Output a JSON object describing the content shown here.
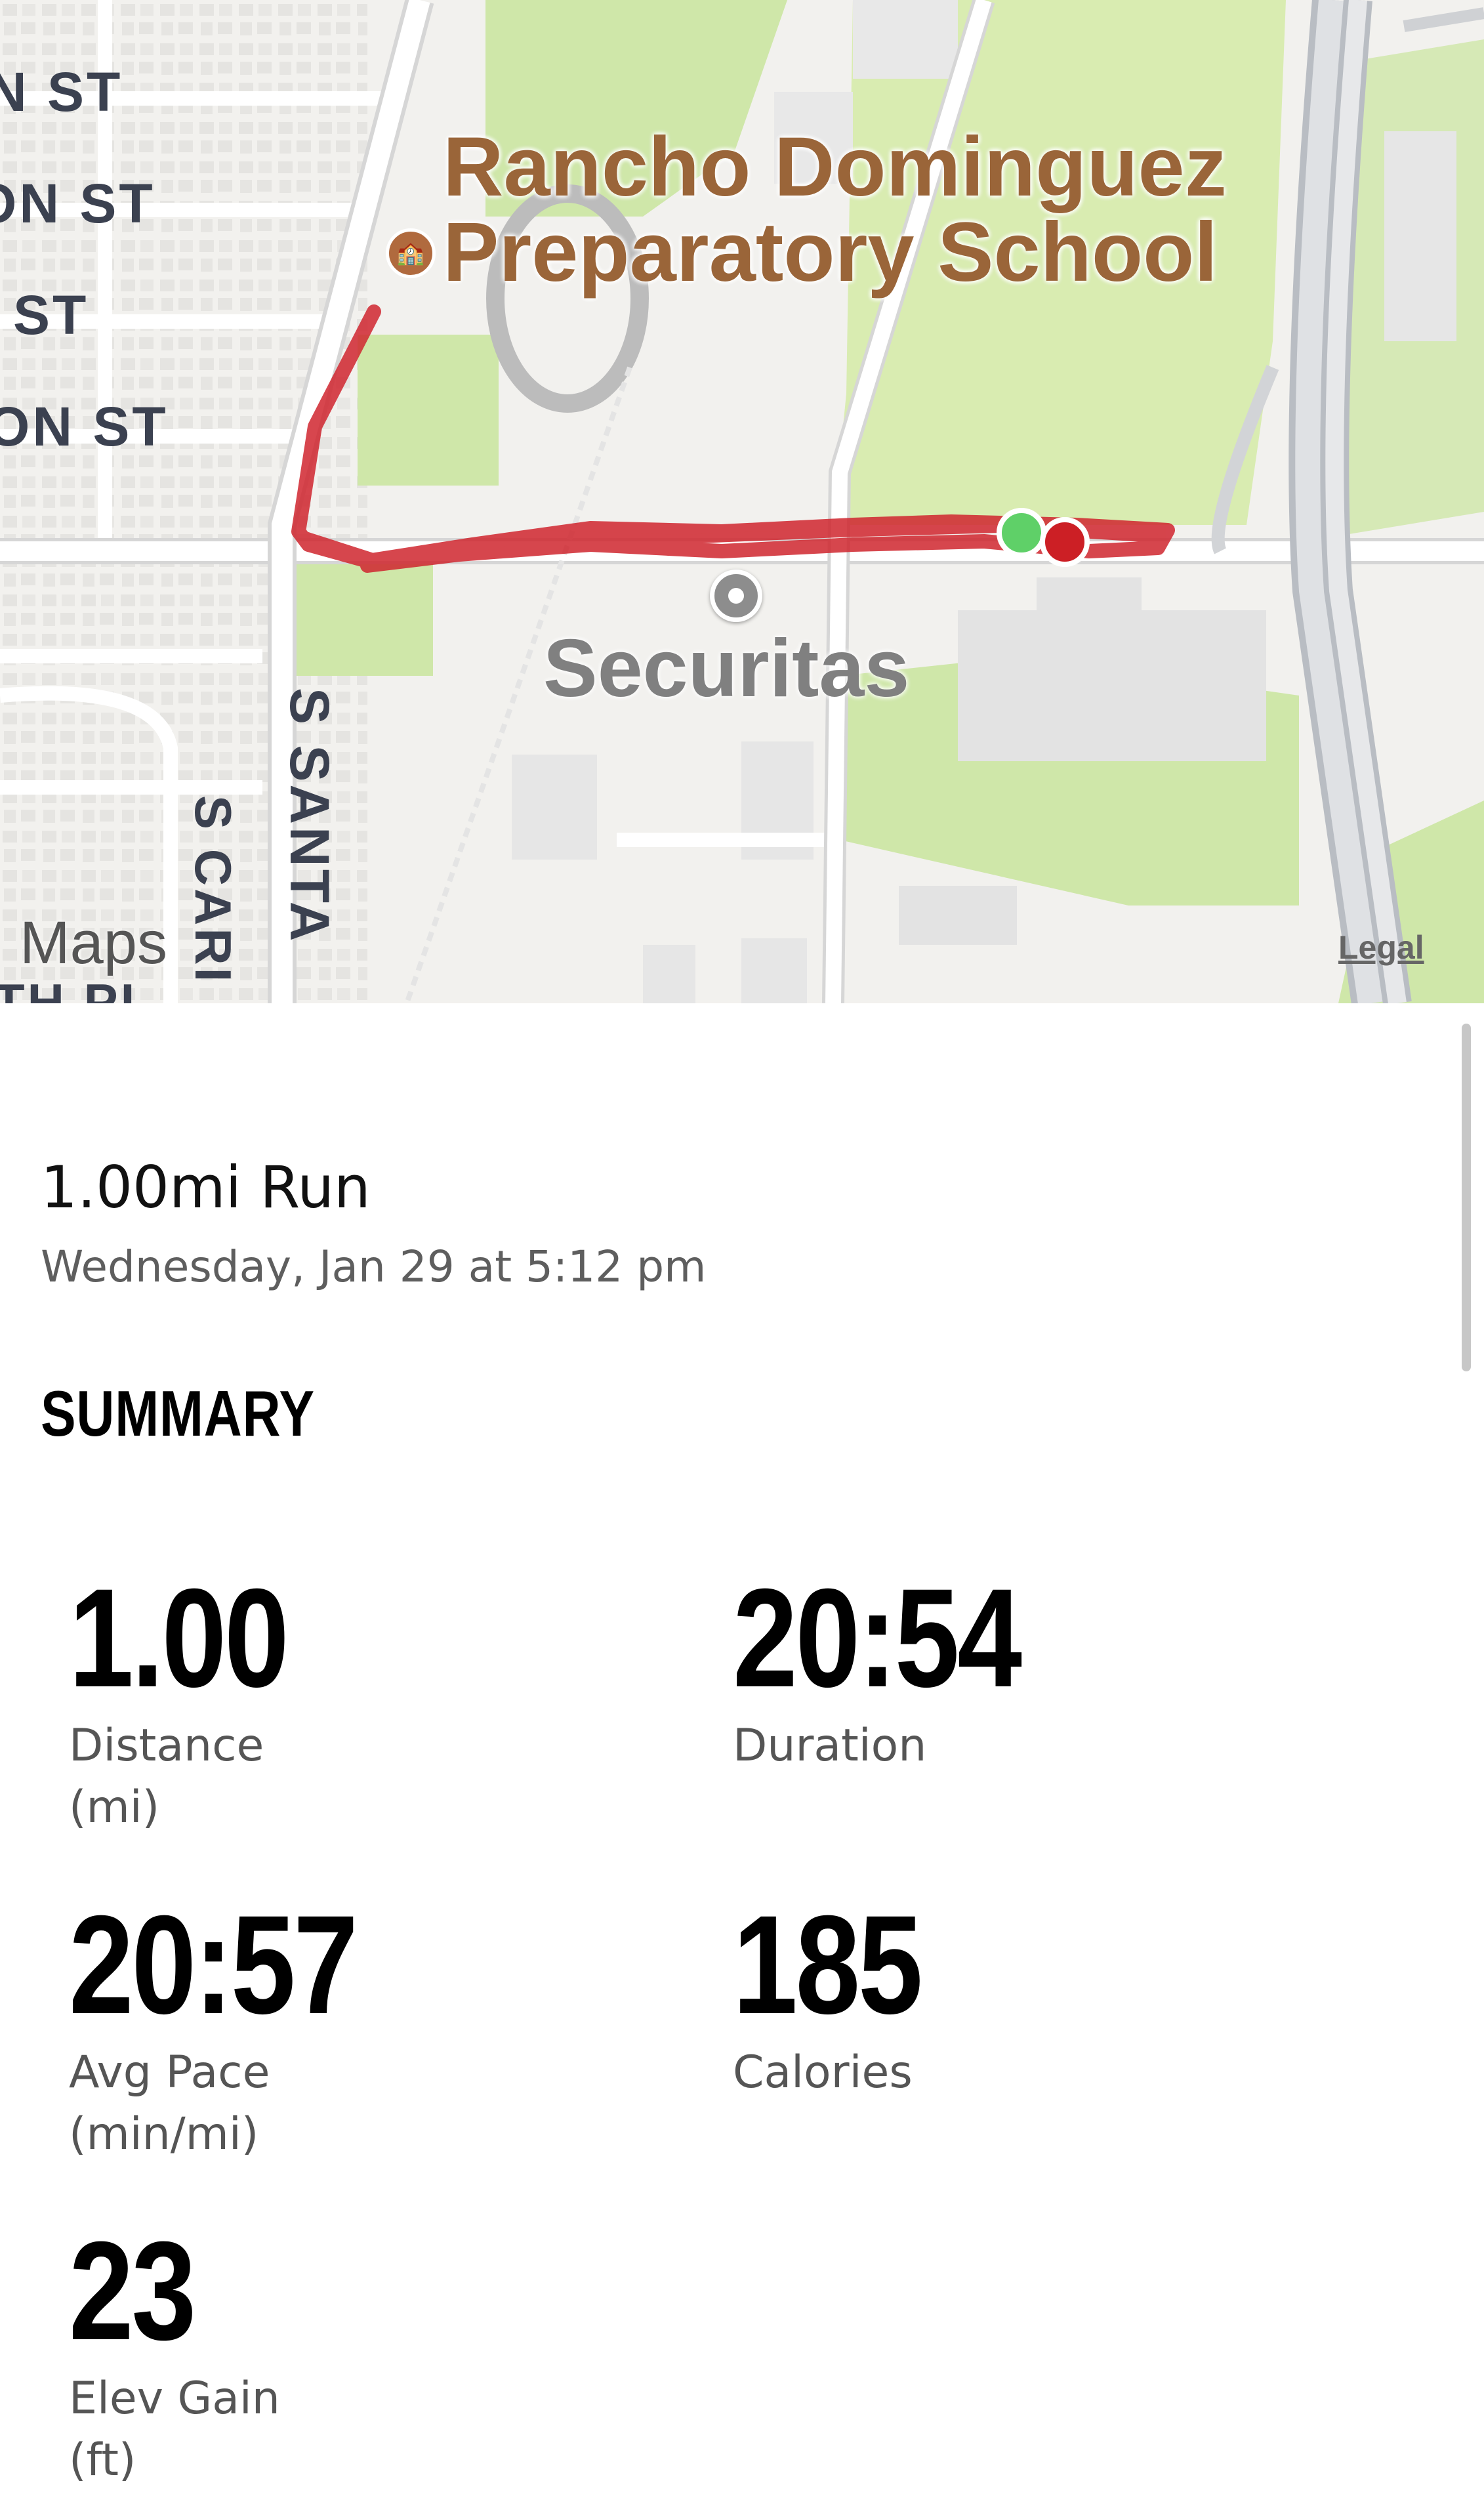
{
  "map": {
    "streets": [
      {
        "id": "s1",
        "label": "N ST"
      },
      {
        "id": "s2",
        "label": "ON ST"
      },
      {
        "id": "s3",
        "label": "ST"
      },
      {
        "id": "s4",
        "label": "ON ST"
      },
      {
        "id": "santa",
        "label": "S SANTA"
      },
      {
        "id": "cari",
        "label": "S CARI"
      },
      {
        "id": "hpl",
        "label": "TH PL"
      }
    ],
    "poi_school": "Rancho Dominguez Preparatory School",
    "poi_security": "Securitas",
    "maps_brand": "Maps",
    "legal": "Legal",
    "colors": {
      "route": "#d0262f",
      "start_marker": "#5fd068",
      "end_marker": "#cc1f25",
      "park": "#cfe7a9",
      "road": "#ffffff"
    }
  },
  "activity": {
    "title": "1.00mi Run",
    "datetime": "Wednesday, Jan 29 at 5:12 pm"
  },
  "summary": {
    "title": "SUMMARY",
    "stats": [
      {
        "value": "1.00",
        "label": "Distance\n(mi)"
      },
      {
        "value": "20:54",
        "label": "Duration"
      },
      {
        "value": "20:57",
        "label": "Avg Pace\n(min/mi)"
      },
      {
        "value": "185",
        "label": "Calories"
      },
      {
        "value": "23",
        "label": "Elev Gain\n(ft)"
      }
    ]
  }
}
